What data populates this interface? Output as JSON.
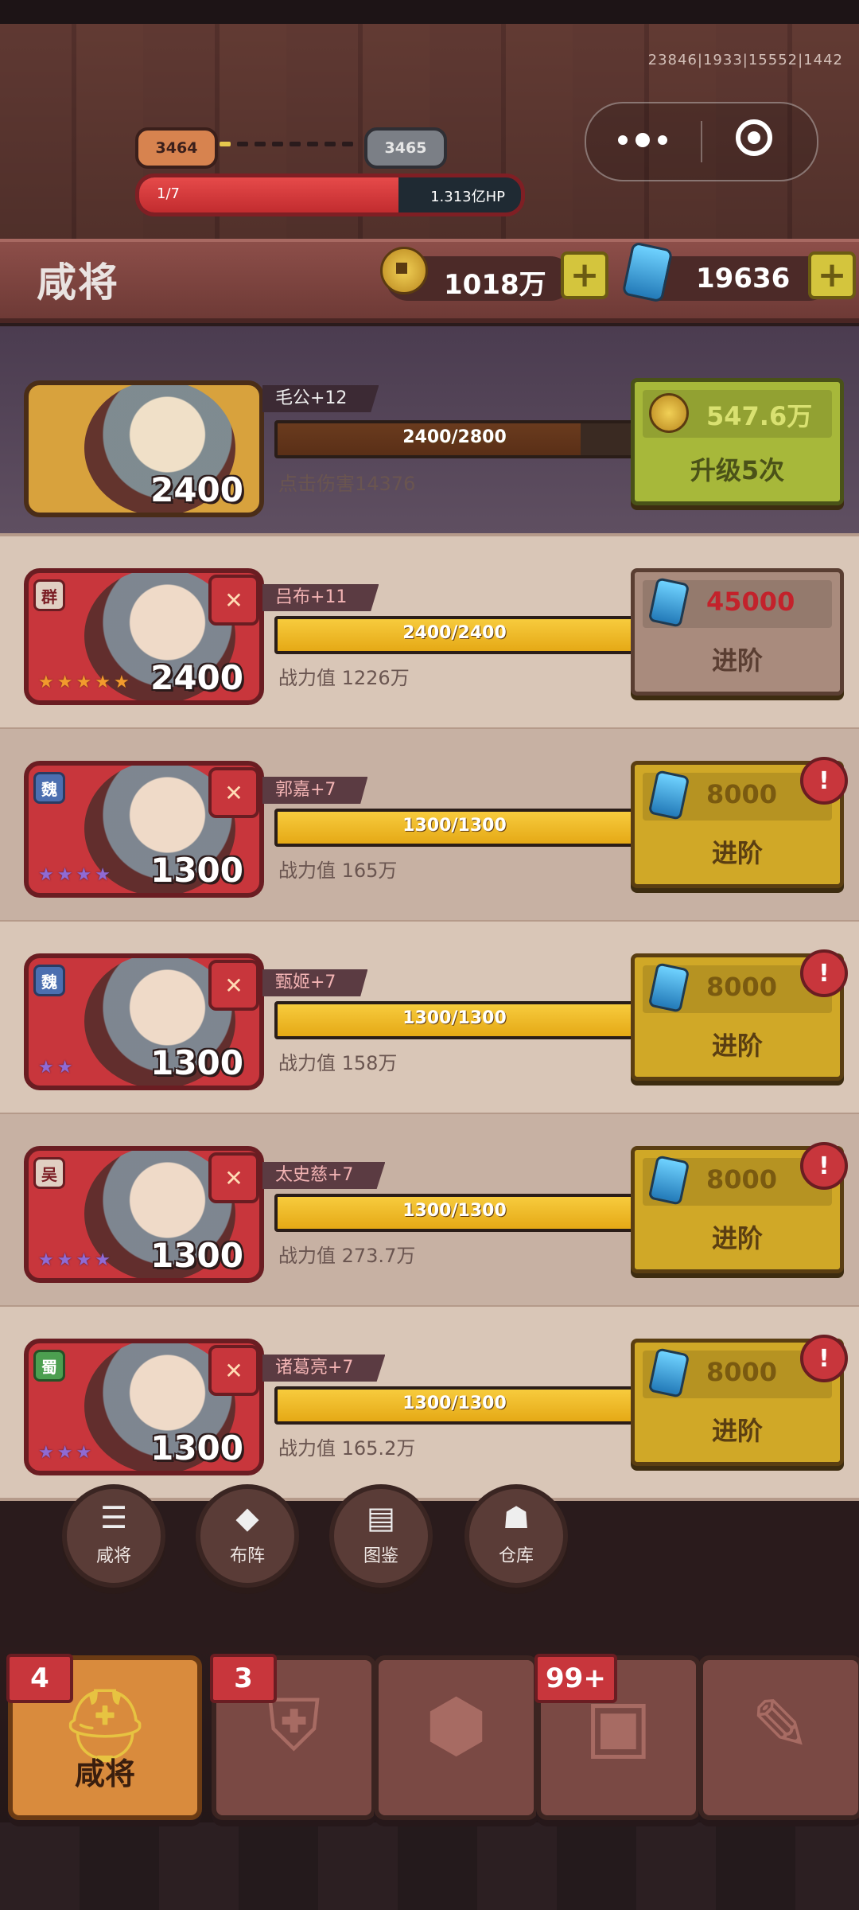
{
  "system": {
    "build_id": "23846|1933|15552|1442",
    "capsule_menu_icon": "more-dots-icon",
    "capsule_target_icon": "target-icon"
  },
  "battle": {
    "wave_current": "3464",
    "wave_next": "3465",
    "hp_left": "1/7",
    "hp_right": "1.313亿HP",
    "hp_fill_fraction": 0.68,
    "wave_progress_fraction": 0.125
  },
  "header": {
    "title": "咸将",
    "coins": "1018万",
    "gems": "19636",
    "coin_icon": "coin-icon",
    "gem_icon": "gem-icon",
    "plus_icon": "plus-icon"
  },
  "hero": {
    "name": "毛公+12",
    "progress": "2400/2800",
    "progress_fraction": 0.857,
    "power": "2400",
    "stat": "点击伤害14376",
    "button_cost": "547.6万",
    "button_label": "升级5次"
  },
  "generals": [
    {
      "faction": "群",
      "faction_class": "qun",
      "name": "吕布+11",
      "progress": "2400/2400",
      "progress_fraction": 1.0,
      "power": "2400",
      "stars": 5,
      "star_color": "orange",
      "stat": "战力值  1226万",
      "cost": "45000",
      "label": "进阶",
      "style": "muted",
      "alert": false
    },
    {
      "faction": "魏",
      "faction_class": "wei",
      "name": "郭嘉+7",
      "progress": "1300/1300",
      "progress_fraction": 1.0,
      "power": "1300",
      "stars": 4,
      "star_color": "purple",
      "stat": "战力值  165万",
      "cost": "8000",
      "label": "进阶",
      "style": "gold",
      "alert": true
    },
    {
      "faction": "魏",
      "faction_class": "wei",
      "name": "甄姬+7",
      "progress": "1300/1300",
      "progress_fraction": 1.0,
      "power": "1300",
      "stars": 2,
      "star_color": "purple",
      "stat": "战力值  158万",
      "cost": "8000",
      "label": "进阶",
      "style": "gold",
      "alert": true
    },
    {
      "faction": "吴",
      "faction_class": "wu",
      "name": "太史慈+7",
      "progress": "1300/1300",
      "progress_fraction": 1.0,
      "power": "1300",
      "stars": 4,
      "star_color": "purple",
      "stat": "战力值  273.7万",
      "cost": "8000",
      "label": "进阶",
      "style": "gold",
      "alert": true
    },
    {
      "faction": "蜀",
      "faction_class": "shu",
      "name": "诸葛亮+7",
      "progress": "1300/1300",
      "progress_fraction": 1.0,
      "power": "1300",
      "stars": 3,
      "star_color": "purple",
      "stat": "战力值  165.2万",
      "cost": "8000",
      "label": "进阶",
      "style": "gold",
      "alert": true
    }
  ],
  "round_nav": [
    {
      "label": "咸将",
      "icon": "list-icon"
    },
    {
      "label": "布阵",
      "icon": "formation-icon"
    },
    {
      "label": "图鉴",
      "icon": "book-icon"
    },
    {
      "label": "仓库",
      "icon": "bag-icon"
    }
  ],
  "bottom_tabs": [
    {
      "label": "咸将",
      "count": "4",
      "icon": "helmet-icon",
      "active": true
    },
    {
      "label": "",
      "count": "3",
      "icon": "armor-icon",
      "active": false
    },
    {
      "label": "",
      "count": "",
      "icon": "tortoise-icon",
      "active": false
    },
    {
      "label": "",
      "count": "99+",
      "icon": "chest-icon",
      "active": false
    },
    {
      "label": "",
      "count": "",
      "icon": "map-scroll-icon",
      "active": false
    }
  ],
  "colors": {
    "accent_gold": "#d0a827",
    "accent_red": "#c8363c",
    "bar_yellow": "#f7cb3d",
    "hp_red": "#e64a4a"
  },
  "text": {
    "alert_mark": "!",
    "badge_mark": "✕",
    "star_glyph": "★"
  }
}
